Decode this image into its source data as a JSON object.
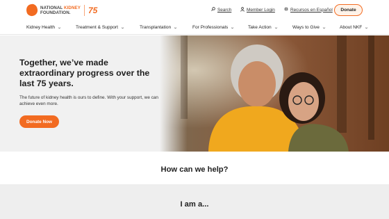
{
  "brand": {
    "line1": "NATIONAL KIDNEY",
    "line1_a": "NATIONAL ",
    "line1_b": "KIDNEY",
    "line2": "FOUNDATION.",
    "anniversary": "75",
    "accent_color": "#f26b21"
  },
  "utility": {
    "search": "Search",
    "member_login": "Member Login",
    "recursos": "Recursos en Español",
    "donate": "Donate"
  },
  "nav": {
    "items": [
      "Kidney Health",
      "Treatment & Support",
      "Transplantation",
      "For Professionals",
      "Take Action",
      "Ways to Give",
      "About NKF"
    ]
  },
  "hero": {
    "title": "Together, we’ve made extraordinary progress over the last 75 years.",
    "body": "The future of kidney health is ours to define. With your support, we can achieve even more.",
    "cta": "Donate Now"
  },
  "sections": {
    "help_title": "How can we help?",
    "iam_title": "I am a..."
  }
}
